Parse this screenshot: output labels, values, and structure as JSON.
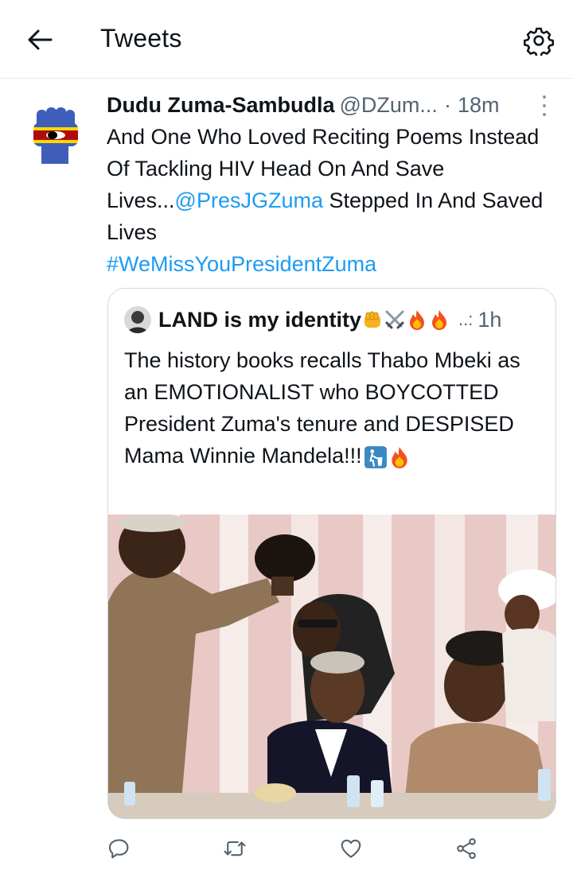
{
  "header": {
    "title": "Tweets",
    "back_icon": "arrow-left-icon",
    "settings_icon": "gear-icon"
  },
  "tweet": {
    "author_name": "Dudu Zuma-Sambudla",
    "author_handle": "@DZum...",
    "separator": "·",
    "time": "18m",
    "avatar_icon": "raised-fist-flag-avatar",
    "text_part1": "And One Who Loved Reciting Poems Instead Of Tackling HIV Head On And Save Lives...",
    "mention": "@PresJGZuma",
    "text_part2": " Stepped In And Saved Lives",
    "hashtag": "#WeMissYouPresidentZuma"
  },
  "quoted_tweet": {
    "author_name": "LAND is my identity",
    "name_emojis": [
      "fist-emoji",
      "crossed-swords-emoji",
      "fire-emoji",
      "fire-emoji"
    ],
    "ellipsis": "..:",
    "time": "1h",
    "text": "The history books recalls Thabo Mbeki as an EMOTIONALIST who BOYCOTTED President Zuma's tenure and DESPISED Mama Winnie Mandela!!!",
    "text_emojis": [
      "litter-bin-emoji",
      "fire-emoji"
    ],
    "photo": "ceremony-photo"
  },
  "actions": {
    "reply_icon": "reply-icon",
    "retweet_icon": "retweet-icon",
    "like_icon": "heart-icon",
    "share_icon": "share-icon"
  },
  "colors": {
    "link": "#1d9bf0",
    "secondary_text": "#536471",
    "border": "#cfd9de"
  }
}
